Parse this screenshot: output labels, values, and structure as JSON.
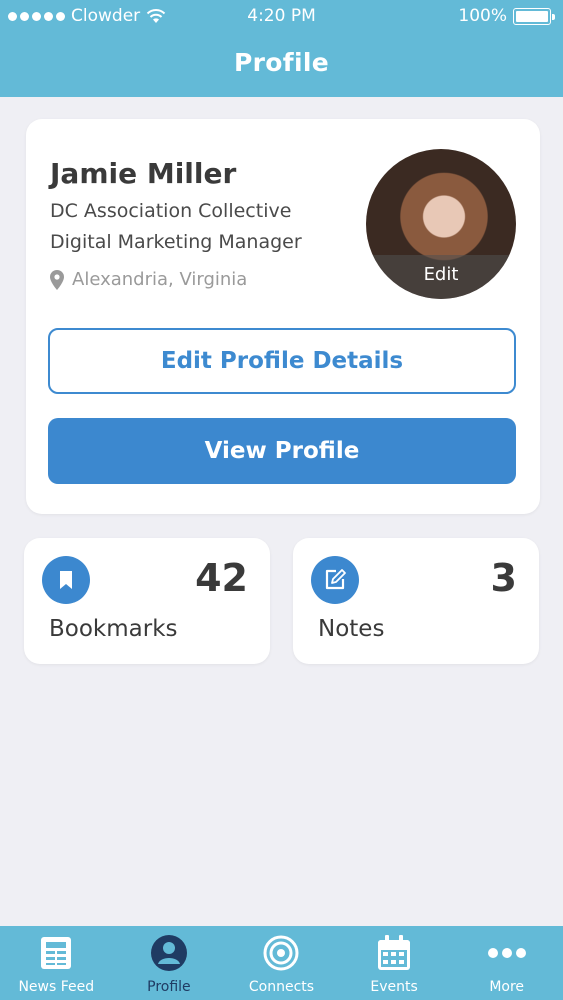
{
  "status_bar": {
    "carrier": "Clowder",
    "time": "4:20 PM",
    "battery": "100%"
  },
  "header": {
    "title": "Profile"
  },
  "profile": {
    "name": "Jamie Miller",
    "organization": "DC Association Collective",
    "job_title": "Digital Marketing Manager",
    "location": "Alexandria, Virginia",
    "avatar_edit_label": "Edit",
    "edit_details_label": "Edit Profile Details",
    "view_profile_label": "View Profile"
  },
  "stats": [
    {
      "label": "Bookmarks",
      "count": "42",
      "icon": "bookmark-icon"
    },
    {
      "label": "Notes",
      "count": "3",
      "icon": "edit-note-icon"
    }
  ],
  "tabbar": {
    "tabs": [
      {
        "label": "News Feed",
        "icon": "newspaper-icon"
      },
      {
        "label": "Profile",
        "icon": "user-icon",
        "active": true
      },
      {
        "label": "Connects",
        "icon": "target-icon"
      },
      {
        "label": "Events",
        "icon": "calendar-icon"
      },
      {
        "label": "More",
        "icon": "more-dots-icon"
      }
    ]
  },
  "colors": {
    "header": "#63bad7",
    "accent": "#3c88cf",
    "background": "#efeff4",
    "active_tab": "#1f3b63"
  }
}
